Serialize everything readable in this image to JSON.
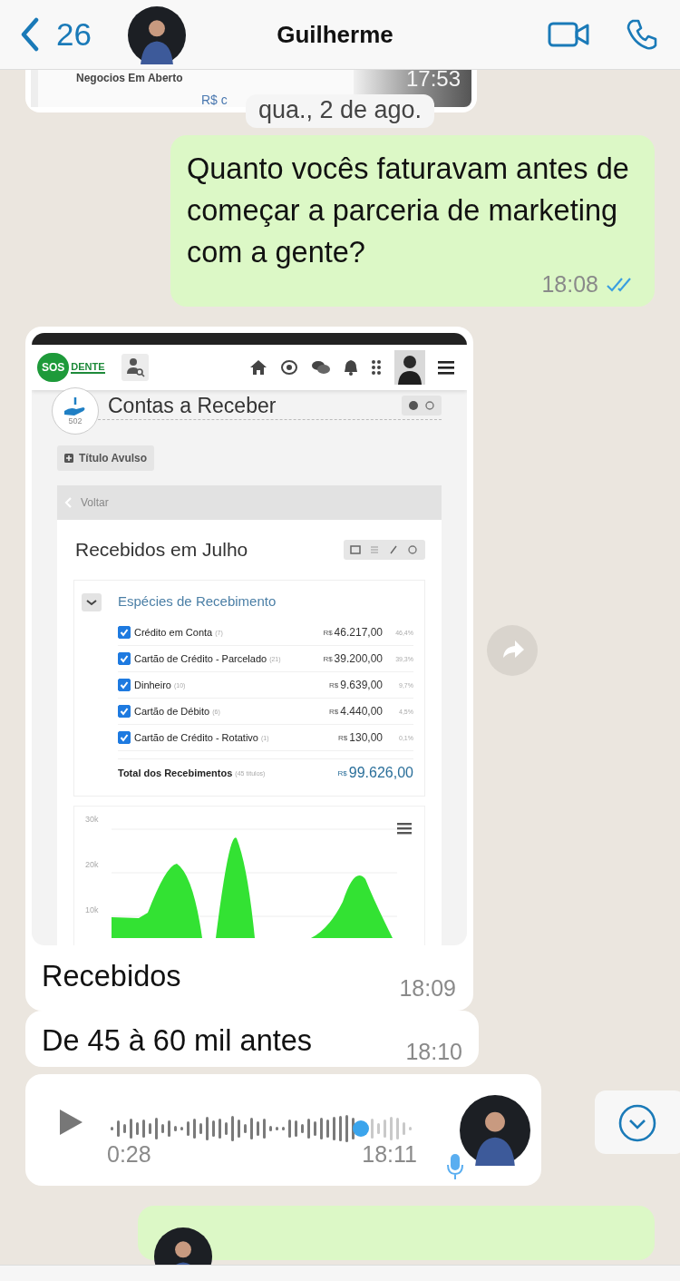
{
  "header": {
    "back_count": "26",
    "contact_name": "Guilherme"
  },
  "messages": [
    {
      "kind": "cut_card",
      "outgoing": false,
      "title": "Negocios Em Aberto",
      "detail": "R$ c",
      "time": "17:53"
    },
    {
      "kind": "date",
      "text": "qua., 2 de ago."
    },
    {
      "kind": "text",
      "outgoing": true,
      "text": "Quanto vocês faturavam antes de começar a parceria de marketing com a gente?",
      "time": "18:08",
      "read": true
    },
    {
      "kind": "image",
      "outgoing": false,
      "caption": "Recebidos",
      "time": "18:09",
      "screenshot": {
        "logo_left": "SOS",
        "logo_right": "DENTE",
        "page_title": "Contas a Receber",
        "page_code": "502",
        "new_button": "Título Avulso",
        "back_link": "Voltar",
        "panel_title": "Recebidos em Julho",
        "section_title": "Espécies de Recebimento",
        "rows": [
          {
            "label": "Crédito em Conta",
            "count": "(7)",
            "currency": "R$",
            "amount": "46.217,00",
            "share": "46,4%",
            "checked": true
          },
          {
            "label": "Cartão de Crédito - Parcelado",
            "count": "(21)",
            "currency": "R$",
            "amount": "39.200,00",
            "share": "39,3%",
            "checked": true
          },
          {
            "label": "Dinheiro",
            "count": "(10)",
            "currency": "R$",
            "amount": "9.639,00",
            "share": "9,7%",
            "checked": true
          },
          {
            "label": "Cartão de Débito",
            "count": "(6)",
            "currency": "R$",
            "amount": "4.440,00",
            "share": "4,5%",
            "checked": true
          },
          {
            "label": "Cartão de Crédito - Rotativo",
            "count": "(1)",
            "currency": "R$",
            "amount": "130,00",
            "share": "0,1%",
            "checked": true
          }
        ],
        "total": {
          "label": "Total dos Recebimentos",
          "count": "(45 títulos)",
          "currency": "R$",
          "amount": "99.626,00"
        },
        "chart_axis_labels": [
          "30k",
          "20k",
          "10k"
        ]
      }
    },
    {
      "kind": "text",
      "outgoing": false,
      "text": "De 45 à 60 mil antes",
      "time": "18:10"
    },
    {
      "kind": "voice",
      "outgoing": false,
      "duration": "0:28",
      "time": "18:11"
    },
    {
      "kind": "cut_out",
      "outgoing": true
    }
  ]
}
